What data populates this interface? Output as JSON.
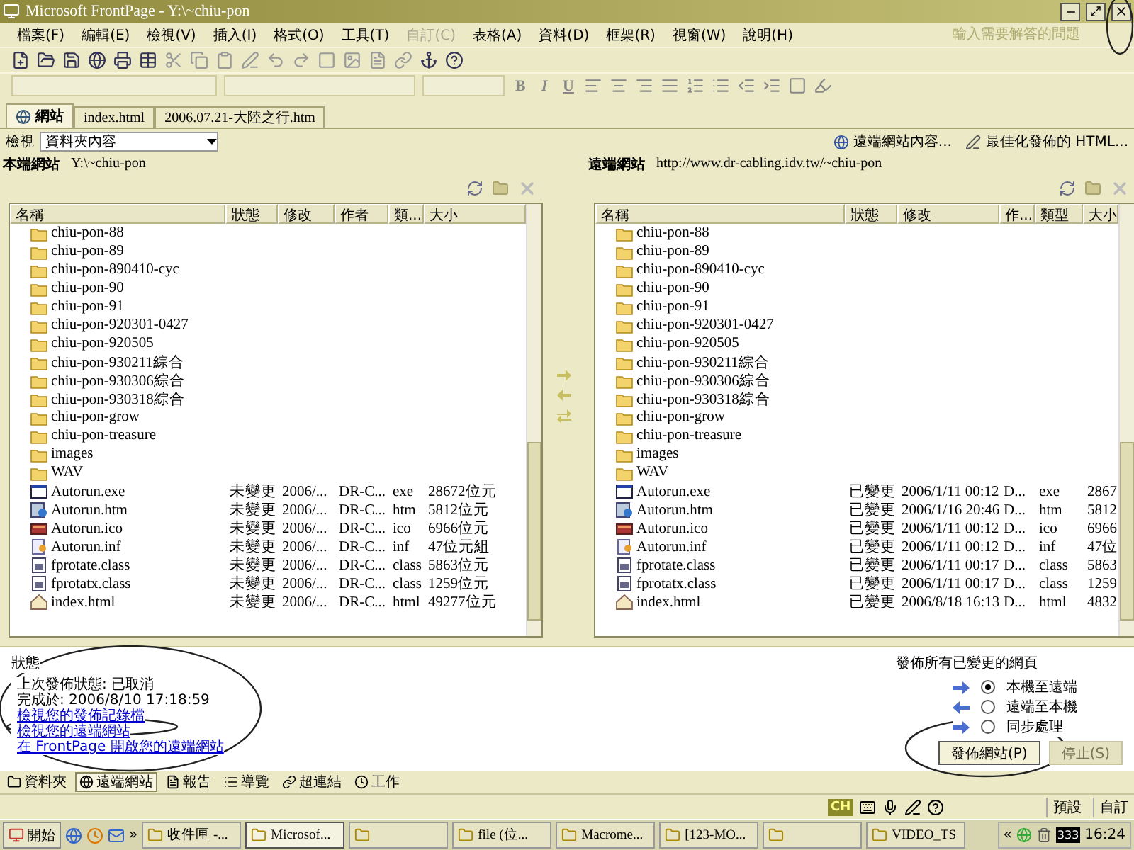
{
  "window": {
    "title": "Microsoft FrontPage - Y:\\~chiu-pon"
  },
  "menu": [
    {
      "label": "檔案(F)",
      "disabled": false
    },
    {
      "label": "編輯(E)",
      "disabled": false
    },
    {
      "label": "檢視(V)",
      "disabled": false
    },
    {
      "label": "插入(I)",
      "disabled": false
    },
    {
      "label": "格式(O)",
      "disabled": false
    },
    {
      "label": "工具(T)",
      "disabled": false
    },
    {
      "label": "自訂(C)",
      "disabled": true
    },
    {
      "label": "表格(A)",
      "disabled": false
    },
    {
      "label": "資料(D)",
      "disabled": false
    },
    {
      "label": "框架(R)",
      "disabled": false
    },
    {
      "label": "視窗(W)",
      "disabled": false
    },
    {
      "label": "說明(H)",
      "disabled": false
    }
  ],
  "help_box": {
    "placeholder": "輸入需要解答的問題"
  },
  "format_buttons": [
    "B",
    "I",
    "U"
  ],
  "tabs": [
    {
      "label": "網站",
      "selected": true
    },
    {
      "label": "index.html",
      "selected": false
    },
    {
      "label": "2006.07.21-大陸之行.htm",
      "selected": false
    }
  ],
  "view": {
    "label": "檢視",
    "value": "資料夾內容"
  },
  "actions": [
    "遠端網站內容...",
    "最佳化發佈的 HTML..."
  ],
  "local": {
    "title": "本端網站",
    "path": "Y:\\~chiu-pon",
    "columns": [
      "名稱",
      "狀態",
      "修改",
      "作者",
      "類...",
      "大小"
    ],
    "rows": [
      {
        "kind": "folder",
        "cells": [
          "chiu-pon-88"
        ]
      },
      {
        "kind": "folder",
        "cells": [
          "chiu-pon-89"
        ]
      },
      {
        "kind": "folder",
        "cells": [
          "chiu-pon-890410-cyc"
        ]
      },
      {
        "kind": "folder",
        "cells": [
          "chiu-pon-90"
        ]
      },
      {
        "kind": "folder",
        "cells": [
          "chiu-pon-91"
        ]
      },
      {
        "kind": "folder",
        "cells": [
          "chiu-pon-920301-0427"
        ]
      },
      {
        "kind": "folder",
        "cells": [
          "chiu-pon-920505"
        ]
      },
      {
        "kind": "folder",
        "cells": [
          "chiu-pon-930211綜合"
        ]
      },
      {
        "kind": "folder",
        "cells": [
          "chiu-pon-930306綜合"
        ]
      },
      {
        "kind": "folder",
        "cells": [
          "chiu-pon-930318綜合"
        ]
      },
      {
        "kind": "folder",
        "cells": [
          "chiu-pon-grow"
        ]
      },
      {
        "kind": "folder",
        "cells": [
          "chiu-pon-treasure"
        ]
      },
      {
        "kind": "folder",
        "cells": [
          "images"
        ]
      },
      {
        "kind": "folder",
        "cells": [
          "WAV"
        ]
      },
      {
        "kind": "program",
        "cells": [
          "Autorun.exe",
          "未變更",
          "2006/...",
          "DR-C...",
          "exe",
          "28672位元"
        ]
      },
      {
        "kind": "web",
        "cells": [
          "Autorun.htm",
          "未變更",
          "2006/...",
          "DR-C...",
          "htm",
          "5812位元"
        ]
      },
      {
        "kind": "image",
        "cells": [
          "Autorun.ico",
          "未變更",
          "2006/...",
          "DR-C...",
          "ico",
          "6966位元"
        ]
      },
      {
        "kind": "setup",
        "cells": [
          "Autorun.inf",
          "未變更",
          "2006/...",
          "DR-C...",
          "inf",
          "47位元組"
        ]
      },
      {
        "kind": "class",
        "cells": [
          "fprotate.class",
          "未變更",
          "2006/...",
          "DR-C...",
          "class",
          "5863位元"
        ]
      },
      {
        "kind": "class",
        "cells": [
          "fprotatx.class",
          "未變更",
          "2006/...",
          "DR-C...",
          "class",
          "1259位元"
        ]
      },
      {
        "kind": "home",
        "cells": [
          "index.html",
          "未變更",
          "2006/...",
          "DR-C...",
          "html",
          "49277位元"
        ]
      }
    ]
  },
  "remote": {
    "title": "遠端網站",
    "path": "http://www.dr-cabling.idv.tw/~chiu-pon",
    "columns": [
      "名稱",
      "狀態",
      "修改",
      "作...",
      "類型",
      "大小"
    ],
    "rows": [
      {
        "kind": "folder",
        "cells": [
          "chiu-pon-88"
        ]
      },
      {
        "kind": "folder",
        "cells": [
          "chiu-pon-89"
        ]
      },
      {
        "kind": "folder",
        "cells": [
          "chiu-pon-890410-cyc"
        ]
      },
      {
        "kind": "folder",
        "cells": [
          "chiu-pon-90"
        ]
      },
      {
        "kind": "folder",
        "cells": [
          "chiu-pon-91"
        ]
      },
      {
        "kind": "folder",
        "cells": [
          "chiu-pon-920301-0427"
        ]
      },
      {
        "kind": "folder",
        "cells": [
          "chiu-pon-920505"
        ]
      },
      {
        "kind": "folder",
        "cells": [
          "chiu-pon-930211綜合"
        ]
      },
      {
        "kind": "folder",
        "cells": [
          "chiu-pon-930306綜合"
        ]
      },
      {
        "kind": "folder",
        "cells": [
          "chiu-pon-930318綜合"
        ]
      },
      {
        "kind": "folder",
        "cells": [
          "chiu-pon-grow"
        ]
      },
      {
        "kind": "folder",
        "cells": [
          "chiu-pon-treasure"
        ]
      },
      {
        "kind": "folder",
        "cells": [
          "images"
        ]
      },
      {
        "kind": "folder",
        "cells": [
          "WAV"
        ]
      },
      {
        "kind": "program",
        "cells": [
          "Autorun.exe",
          "已變更",
          "2006/1/11 00:12",
          "D...",
          "exe",
          "2867"
        ]
      },
      {
        "kind": "web",
        "cells": [
          "Autorun.htm",
          "已變更",
          "2006/1/16 20:46",
          "D...",
          "htm",
          "5812"
        ]
      },
      {
        "kind": "image",
        "cells": [
          "Autorun.ico",
          "已變更",
          "2006/1/11 00:12",
          "D...",
          "ico",
          "6966"
        ]
      },
      {
        "kind": "setup",
        "cells": [
          "Autorun.inf",
          "已變更",
          "2006/1/11 00:12",
          "D...",
          "inf",
          "47位"
        ]
      },
      {
        "kind": "class",
        "cells": [
          "fprotate.class",
          "已變更",
          "2006/1/11 00:17",
          "D...",
          "class",
          "5863"
        ]
      },
      {
        "kind": "class",
        "cells": [
          "fprotatx.class",
          "已變更",
          "2006/1/11 00:17",
          "D...",
          "class",
          "1259"
        ]
      },
      {
        "kind": "home",
        "cells": [
          "index.html",
          "已變更",
          "2006/8/18 16:13",
          "D...",
          "html",
          "4832"
        ]
      }
    ]
  },
  "status": {
    "heading": "狀態",
    "lines": [
      "上次發佈狀態: 已取消",
      "完成於: 2006/8/10 17:18:59"
    ],
    "links": [
      "檢視您的發佈記錄檔",
      "檢視您的遠端網站",
      "在 FrontPage 開啟您的遠端網站"
    ]
  },
  "publish": {
    "heading": "發佈所有已變更的網頁",
    "options": [
      {
        "label": "本機至遠端",
        "selected": true
      },
      {
        "label": "遠端至本機",
        "selected": false
      },
      {
        "label": "同步處理",
        "selected": false
      }
    ],
    "button": "發佈網站(P)",
    "stop": {
      "label": "停止(S)",
      "disabled": true
    }
  },
  "view_tabs": [
    {
      "label": "資料夾",
      "selected": false
    },
    {
      "label": "遠端網站",
      "selected": true
    },
    {
      "label": "報告",
      "selected": false
    },
    {
      "label": "導覽",
      "selected": false
    },
    {
      "label": "超連結",
      "selected": false
    },
    {
      "label": "工作",
      "selected": false
    }
  ],
  "status_bar": {
    "ime": "CH",
    "cells": [
      "預設",
      "自訂"
    ]
  },
  "taskbar": {
    "start": "開始",
    "more": "»",
    "items": [
      {
        "label": "收件匣 -...",
        "selected": false
      },
      {
        "label": "Microsof...",
        "selected": true
      },
      {
        "selected": false
      },
      {
        "label": "file (位...",
        "selected": false
      },
      {
        "label": "Macrome...",
        "selected": false
      },
      {
        "label": "[123-MO...",
        "selected": false
      },
      {
        "selected": false
      },
      {
        "label": "VIDEO_TS",
        "selected": false
      }
    ],
    "tray_more": "«",
    "tray_badge": "333",
    "clock": "16:24"
  }
}
